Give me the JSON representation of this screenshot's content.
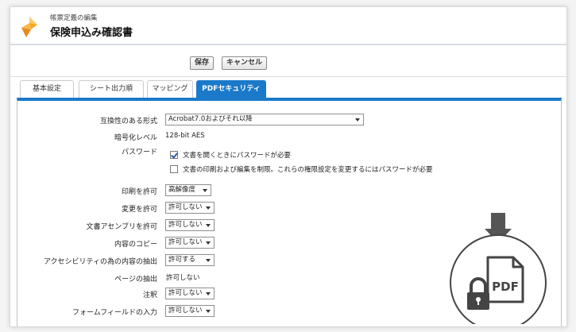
{
  "header": {
    "breadcrumb": "帳票定義の編集",
    "title": "保険申込み確認書"
  },
  "toolbar": {
    "save_label": "保存",
    "cancel_label": "キャンセル"
  },
  "tabs": [
    {
      "label": "基本設定",
      "active": false
    },
    {
      "label": "シート出力順",
      "active": false
    },
    {
      "label": "マッピング",
      "active": false
    },
    {
      "label": "PDFセキュリティ",
      "active": true
    }
  ],
  "form": {
    "compat": {
      "label": "互換性のある形式",
      "value": "Acrobat7.0およびそれ以降"
    },
    "encryption": {
      "label": "暗号化レベル",
      "value": "128-bit AES"
    },
    "password": {
      "label": "パスワード",
      "open_password": {
        "text": "文書を開くときにパスワードが必要",
        "checked": true
      },
      "permission_password": {
        "text": "文書の印刷および編集を制限。これらの権限設定を変更するにはパスワードが必要",
        "checked": false
      }
    },
    "print": {
      "label": "印刷を許可",
      "value": "高解像度"
    },
    "change": {
      "label": "変更を許可",
      "value": "許可しない"
    },
    "assemble": {
      "label": "文書アセンブリを許可",
      "value": "許可しない"
    },
    "copy": {
      "label": "内容のコピー",
      "value": "許可しない"
    },
    "accessibility": {
      "label": "アクセシビリティの為の内容の抽出",
      "value": "許可する"
    },
    "page_extract": {
      "label": "ページの抽出",
      "value": "許可しない"
    },
    "comments": {
      "label": "注釈",
      "value": "許可しない"
    },
    "form_fill": {
      "label": "フォームフィールドの入力",
      "value": "許可しない"
    }
  },
  "badge": {
    "text": "PDF"
  },
  "colors": {
    "accent": "#1b79c9",
    "logo_orange": "#f5a623"
  }
}
